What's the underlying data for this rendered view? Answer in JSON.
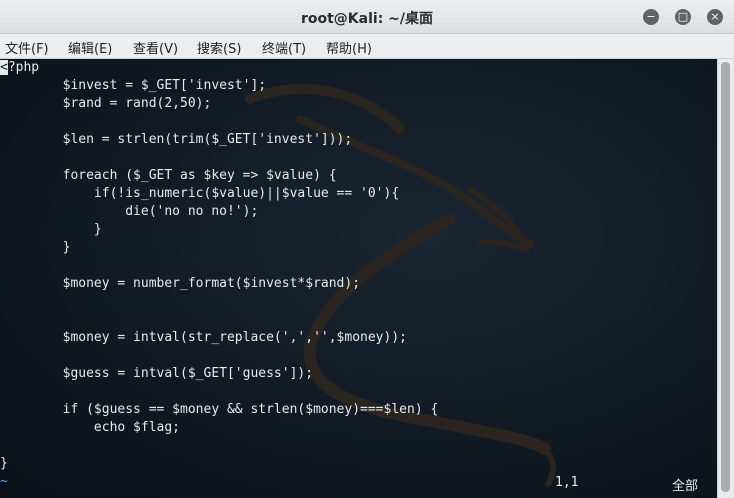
{
  "window": {
    "title": "root@Kali: ~/桌面"
  },
  "menu": [
    "文件(F)",
    "编辑(E)",
    "查看(V)",
    "搜索(S)",
    "终端(T)",
    "帮助(H)"
  ],
  "code_first": "?php",
  "code_first_cursor": "<",
  "code_lines": [
    "",
    "        $invest = $_GET['invest'];",
    "        $rand = rand(2,50);",
    "",
    "        $len = strlen(trim($_GET['invest']));",
    "",
    "        foreach ($_GET as $key => $value) {",
    "            if(!is_numeric($value)||$value == '0'){",
    "                die('no no no!');",
    "            }",
    "        }",
    "",
    "        $money = number_format($invest*$rand);",
    "",
    "",
    "        $money = intval(str_replace(',','',$money));",
    "",
    "        $guess = intval($_GET['guess']);",
    "",
    "        if ($guess == $money && strlen($money)===$len) {",
    "            echo $flag;",
    "",
    "}",
    "~"
  ],
  "status": {
    "position": "1,1",
    "scope": "全部"
  }
}
